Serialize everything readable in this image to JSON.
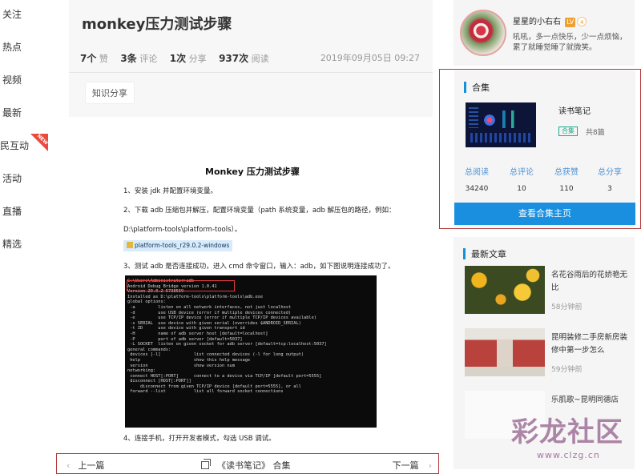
{
  "left_nav": {
    "items": [
      "关注",
      "热点",
      "视频",
      "最新",
      "农民互动",
      "活动",
      "直播",
      "精选"
    ],
    "new_badge": "NEW"
  },
  "article_header": {
    "title": "monkey压力测试步骤",
    "stats": [
      {
        "value": "7个",
        "label": "赞"
      },
      {
        "value": "3条",
        "label": "评论"
      },
      {
        "value": "1次",
        "label": "分享"
      },
      {
        "value": "937次",
        "label": "阅读"
      }
    ],
    "date": "2019年09月05日 09:27",
    "tag": "知识分享"
  },
  "article": {
    "heading": "Monkey 压力测试步骤",
    "step1": "1、安装 jdk 并配置环境变量。",
    "step2": "2、下载 adb 压缩包并解压，配置环境变量（path 系统变量，adb 解压包的路径，例如：",
    "path": "D:\\platform-tools\\platform-tools）。",
    "file_chip": "platform-tools_r29.0.2-windows",
    "step3": "3、测试 adb 是否连接成功，进入 cmd 命令窗口，输入：adb，如下图说明连接成功了。",
    "terminal": [
      "C:\\Users\\Administrator>adb",
      "Android Debug Bridge version 1.0.41",
      "Version 29.0.2-5738569",
      "Installed as D:\\platform-tools\\platform-tools\\adb.exe",
      "",
      "global options:",
      " -a         listen on all network interfaces, not just localhost",
      " -d         use USB device (error if multiple devices connected)",
      " -e         use TCP/IP device (error if multiple TCP/IP devices available)",
      " -s SERIAL  use device with given serial (overrides $ANDROID_SERIAL)",
      " -t ID      use device with given transport id",
      " -H         name of adb server host [default=localhost]",
      " -P         port of adb server [default=5037]",
      " -L SOCKET  listen on given socket for adb server [default=tcp:localhost:5037]",
      "",
      "general commands:",
      " devices [-l]             list connected devices (-l for long output)",
      " help                     show this help message",
      " version                  show version num",
      "",
      "networking:",
      " connect HOST[:PORT]      connect to a device via TCP/IP [default port=5555]",
      " disconnect [HOST[:PORT]]",
      "     disconnect from given TCP/IP device [default port=5555], or all",
      " forward --list           list all forward socket connections"
    ],
    "step4": "4、连接手机，打开开发者模式，勾选 USB 调试。"
  },
  "bottom_bar": {
    "prev": "上一篇",
    "center": "《读书笔记》 合集",
    "next": "下一篇"
  },
  "profile": {
    "name": "星星的小右右",
    "level": "LV",
    "level_num": "4",
    "bio": "吼吼，多一点快乐，少一点烦恼，累了就睡觉睡了就微笑。"
  },
  "collection": {
    "section_title": "合集",
    "name": "读书笔记",
    "badge": "合集",
    "count": "共8篇",
    "stats": [
      {
        "label": "总阅读",
        "value": "34240"
      },
      {
        "label": "总评论",
        "value": "10"
      },
      {
        "label": "总获赞",
        "value": "110"
      },
      {
        "label": "总分享",
        "value": "3"
      }
    ],
    "button": "查看合集主页"
  },
  "recent": {
    "section_title": "最新文章",
    "items": [
      {
        "title": "名花谷雨后的花娇艳无比",
        "time": "58分钟前"
      },
      {
        "title": "昆明装修二手房新房装修中第一步怎么",
        "time": "59分钟前"
      },
      {
        "title": "乐肌歌~昆明同德店",
        "time": ""
      }
    ]
  },
  "watermark": {
    "logo": "彩龙社区",
    "url": "www.clzg.cn"
  },
  "colors": {
    "accent": "#1a8fe0",
    "section_bar": "#1890d8",
    "badge_green": "#1aa98a",
    "new_badge": "#e84a3c",
    "level": "#f0a030"
  }
}
